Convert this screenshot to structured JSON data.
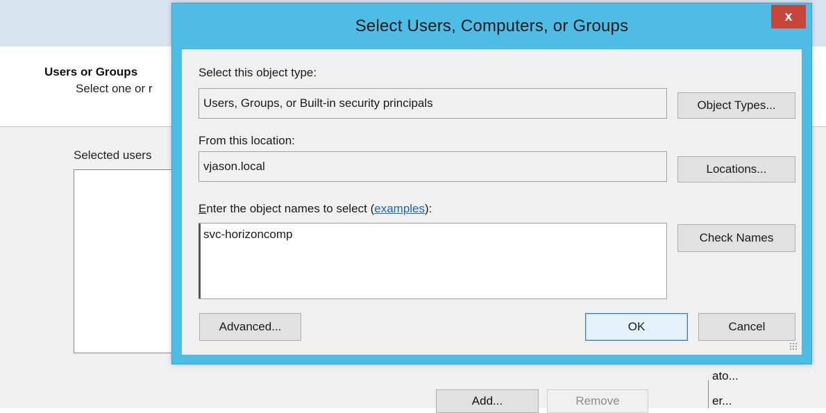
{
  "background_window": {
    "title": "Users or Groups",
    "subtitle": "Select one or r",
    "selected_label": "Selected users",
    "add_label": "Add...",
    "remove_label": "Remove",
    "right_items": [
      "ato...",
      "er..."
    ]
  },
  "dialog": {
    "title": "Select Users, Computers, or Groups",
    "close_glyph": "x",
    "object_type_label": "Select this object type:",
    "object_type_value": "Users, Groups, or Built-in security principals",
    "object_types_button": "Object Types...",
    "location_label": "From this location:",
    "location_value": "vjason.local",
    "locations_button": "Locations...",
    "names_label_underlined": "E",
    "names_label_rest": "nter the object names to select (",
    "names_label_link": "examples",
    "names_label_end": "):",
    "names_value": "svc-horizoncomp",
    "check_names_button": "Check Names",
    "advanced_button": "Advanced...",
    "ok_button": "OK",
    "cancel_button": "Cancel"
  },
  "colors": {
    "title_bar": "#4ebde6",
    "close_button": "#c7453b",
    "link": "#1a64c9"
  }
}
